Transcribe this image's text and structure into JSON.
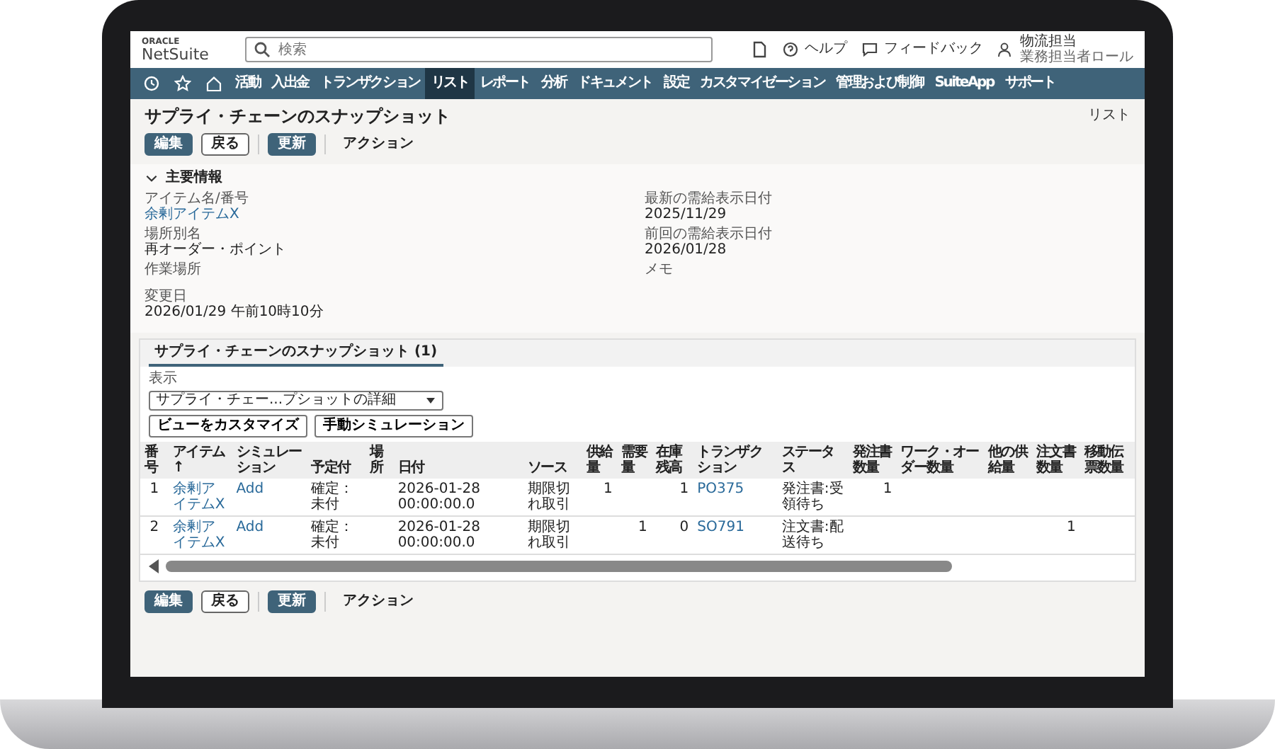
{
  "header": {
    "logo_top": "ORACLE",
    "logo": "NetSuite",
    "search": {
      "placeholder": "検索"
    },
    "help": "ヘルプ",
    "feedback": "フィードバック",
    "user": {
      "name": "物流担当",
      "role": "業務担当者ロール"
    }
  },
  "nav": [
    {
      "label": "活動",
      "selected": false
    },
    {
      "label": "入出金",
      "selected": false
    },
    {
      "label": "トランザクション",
      "selected": false
    },
    {
      "label": "リスト",
      "selected": true
    },
    {
      "label": "レポート",
      "selected": false
    },
    {
      "label": "分析",
      "selected": false
    },
    {
      "label": "ドキュメント",
      "selected": false
    },
    {
      "label": "設定",
      "selected": false
    },
    {
      "label": "カスタマイゼーション",
      "selected": false
    },
    {
      "label": "管理および制御",
      "selected": false
    },
    {
      "label": "SuiteApp",
      "selected": false
    },
    {
      "label": "サポート",
      "selected": false
    }
  ],
  "page": {
    "title": "サプライ・チェーンのスナップショット",
    "list_link": "リスト"
  },
  "buttons": [
    {
      "label": "編集",
      "kind": "primary"
    },
    {
      "label": "戻る",
      "kind": "secondary"
    },
    {
      "label": "更新",
      "kind": "primary"
    },
    {
      "label": "アクション",
      "kind": "menu"
    }
  ],
  "main_info": {
    "heading": "主要情報",
    "expanded": true,
    "left": [
      {
        "label": "アイテム名/番号",
        "value": "余剰アイテムX",
        "kind": "link"
      },
      {
        "label": "場所別名",
        "value": "再オーダー・ポイント",
        "kind": "text"
      },
      {
        "label": "作業場所"
      }
    ],
    "right": [
      {
        "label": "最新の需給表示日付",
        "value": "2025/11/29",
        "kind": "text"
      },
      {
        "label": "前回の需給表示日付",
        "value": "2026/01/28",
        "kind": "text"
      },
      {
        "label": "メモ"
      }
    ],
    "modified": {
      "label": "変更日",
      "value": "2026/01/29 午前10時10分"
    }
  },
  "subtabs": [
    {
      "label": "サプライ・チェーンのスナップショット (1)",
      "selected": true
    }
  ],
  "view": {
    "label": "表示",
    "value": "サプライ・チェー...プショットの詳細"
  },
  "tools": [
    "ビューをカスタマイズ",
    "手動シミュレーション"
  ],
  "table": {
    "columns": [
      {
        "label": "番号",
        "kind": "center"
      },
      {
        "label": "アイテム ↑",
        "kind": "link"
      },
      {
        "label": "シミュレーション",
        "kind": "link"
      },
      {
        "label": "予定付",
        "kind": "text"
      },
      {
        "label": "場所",
        "kind": "text"
      },
      {
        "label": "日付",
        "kind": "text"
      },
      {
        "label": "ソース",
        "kind": "text"
      },
      {
        "label": "供給量",
        "kind": "number"
      },
      {
        "label": "需要量",
        "kind": "number"
      },
      {
        "label": "在庫残高",
        "kind": "number"
      },
      {
        "label": "トランザクション",
        "kind": "link"
      },
      {
        "label": "ステータス",
        "kind": "text"
      },
      {
        "label": "発注書数量",
        "kind": "number"
      },
      {
        "label": "ワーク・オーダー数量",
        "kind": "number"
      },
      {
        "label": "他の供給量",
        "kind": "number"
      },
      {
        "label": "注文書数量",
        "kind": "number"
      },
      {
        "label": "移動伝票数量",
        "kind": "number"
      }
    ],
    "rows": [
      [
        "1",
        "余剰アイテムX",
        "Add",
        "確定：未付",
        null,
        "2026-01-28 00:00:00.0",
        "期限切れ取引",
        "1",
        null,
        "1",
        "PO375",
        "発注書:受領待ち",
        "1",
        null,
        null,
        null,
        null
      ],
      [
        "2",
        "余剰アイテムX",
        "Add",
        "確定：未付",
        null,
        "2026-01-28 00:00:00.0",
        "期限切れ取引",
        null,
        "1",
        "0",
        "SO791",
        "注文書:配送待ち",
        null,
        null,
        null,
        "1",
        null
      ]
    ]
  },
  "bottom_buttons": [
    {
      "label": "編集",
      "kind": "primary"
    },
    {
      "label": "戻る",
      "kind": "secondary"
    },
    {
      "label": "更新",
      "kind": "primary"
    },
    {
      "label": "アクション",
      "kind": "menu"
    }
  ]
}
